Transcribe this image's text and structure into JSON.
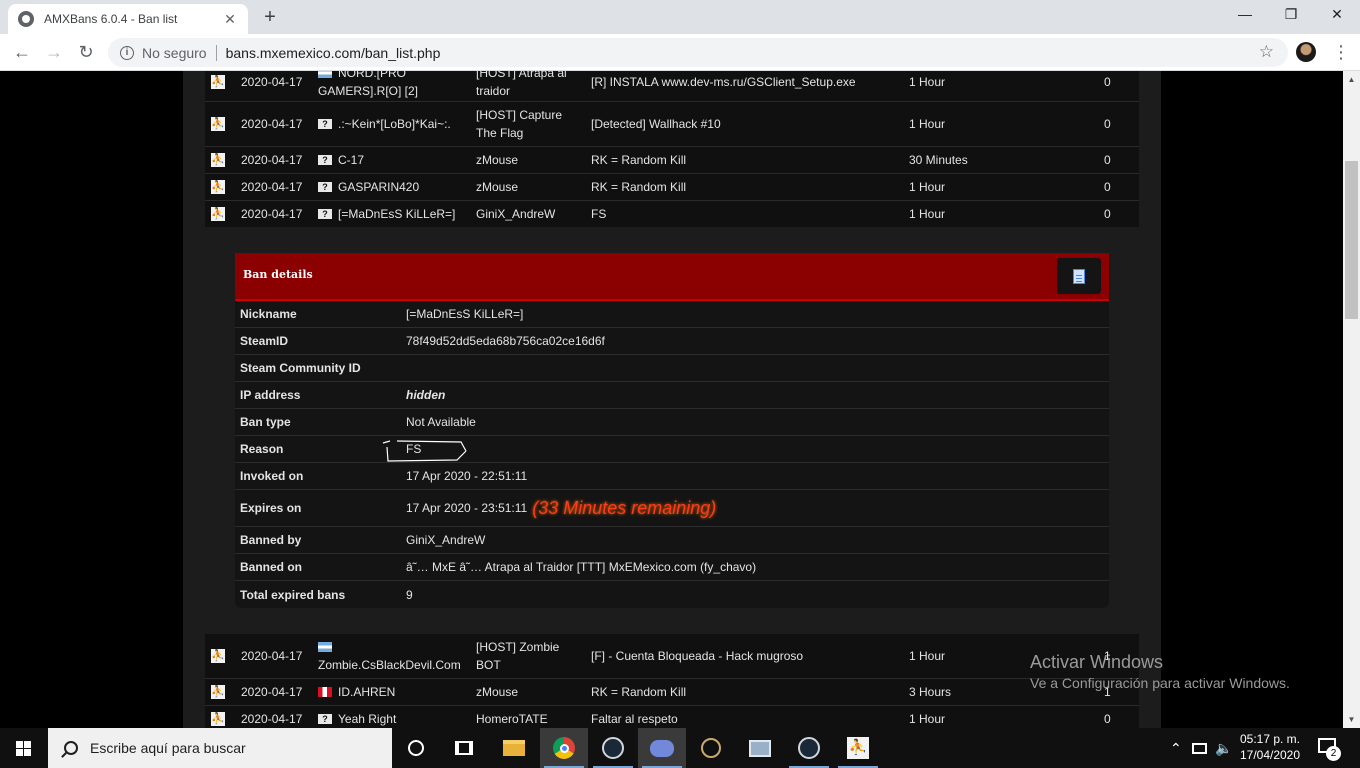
{
  "browser": {
    "tab_title": "AMXBans 6.0.4 - Ban list",
    "tab_close": "✕",
    "new_tab": "+",
    "minimize": "—",
    "maximize": "❐",
    "close": "✕",
    "back": "←",
    "forward": "→",
    "reload": "↻",
    "info_glyph": "i",
    "security_label": "No seguro",
    "url": "bans.mxemexico.com/ban_list.php",
    "star": "☆",
    "menu": "⋮"
  },
  "bans_top": [
    {
      "date": "2020-04-17",
      "flag": "ar",
      "nick": "NORD.[PRO GAMERS].R[O] [2]",
      "server": "[HOST] Atrapa al traidor",
      "reason": "[R] INSTALA www.dev-ms.ru/GSClient_Setup.exe",
      "length": "1 Hour",
      "expired": "0"
    },
    {
      "date": "2020-04-17",
      "flag": "unknown",
      "nick": ".:~Kein*[LoBo]*Kai~:.",
      "server": "[HOST] Capture The Flag",
      "reason": "[Detected] Wallhack #10",
      "length": "1 Hour",
      "expired": "0"
    },
    {
      "date": "2020-04-17",
      "flag": "unknown",
      "nick": "C-17",
      "server": "zMouse",
      "reason": "RK = Random Kill",
      "length": "30 Minutes",
      "expired": "0"
    },
    {
      "date": "2020-04-17",
      "flag": "unknown",
      "nick": "GASPARIN420",
      "server": "zMouse",
      "reason": "RK = Random Kill",
      "length": "1 Hour",
      "expired": "0"
    },
    {
      "date": "2020-04-17",
      "flag": "unknown",
      "nick": "[=MaDnEsS KiLLeR=]",
      "server": "GiniX_AndreW",
      "reason": "FS",
      "length": "1 Hour",
      "expired": "0"
    }
  ],
  "details": {
    "title": "Ban details",
    "nickname_label": "Nickname",
    "nickname": "[=MaDnEsS KiLLeR=]",
    "steamid_label": "SteamID",
    "steamid": "78f49d52dd5eda68b756ca02ce16d6f",
    "community_label": "Steam Community ID",
    "community": "",
    "ip_label": "IP address",
    "ip": "hidden",
    "bantype_label": "Ban type",
    "bantype": "Not Available",
    "reason_label": "Reason",
    "reason": "FS",
    "invoked_label": "Invoked on",
    "invoked": "17 Apr 2020 - 22:51:11",
    "expires_label": "Expires on",
    "expires": "17 Apr 2020 - 23:51:11",
    "remaining": "(33 Minutes remaining)",
    "bannedby_label": "Banned by",
    "bannedby": "GiniX_AndreW",
    "bannedon_label": "Banned on",
    "bannedon": "â˜… MxE â˜… Atrapa al Traidor [TTT] MxEMexico.com (fy_chavo)",
    "total_label": "Total expired bans",
    "total": "9"
  },
  "bans_bottom": [
    {
      "date": "2020-04-17",
      "flag": "ar",
      "nick": "Zombie.CsBlackDevil.Com",
      "server": "[HOST] Zombie BOT",
      "reason": "[F] - Cuenta Bloqueada - Hack mugroso",
      "length": "1 Hour",
      "expired": "1"
    },
    {
      "date": "2020-04-17",
      "flag": "pe",
      "nick": "ID.AHREN",
      "server": "zMouse",
      "reason": "RK = Random Kill",
      "length": "3 Hours",
      "expired": "1"
    },
    {
      "date": "2020-04-17",
      "flag": "unknown",
      "nick": "Yeah Right",
      "server": "HomeroTATE",
      "reason": "Faltar al respeto",
      "length": "1 Hour",
      "expired": "0"
    }
  ],
  "watermark": {
    "title": "Activar Windows",
    "subtitle": "Ve a Configuración para activar Windows."
  },
  "taskbar": {
    "search_placeholder": "Escribe aquí para buscar",
    "time": "05:17 p. m.",
    "date": "17/04/2020",
    "notification_count": "2"
  },
  "colors": {
    "details_header": "#8b0000",
    "remaining": "#ff3a1a",
    "page_bg": "#1c1c1c"
  }
}
